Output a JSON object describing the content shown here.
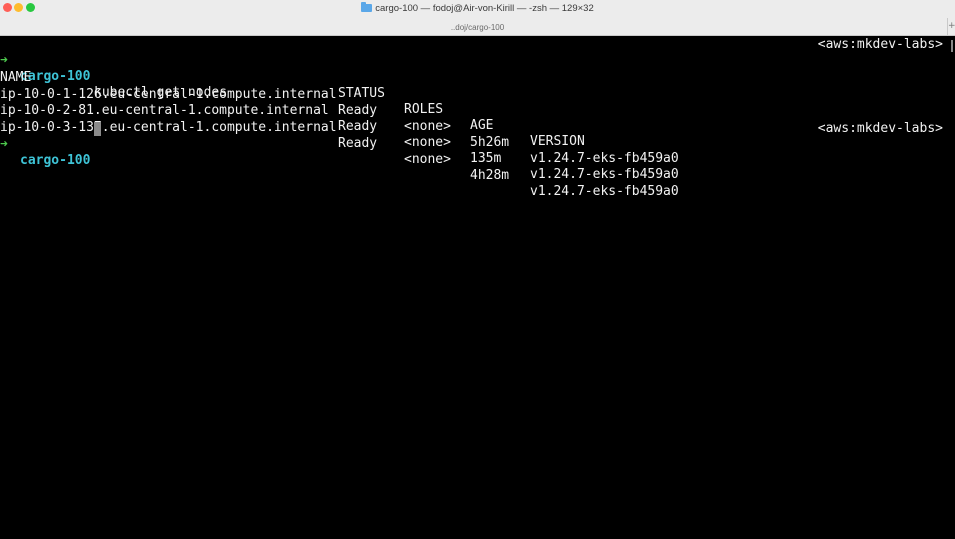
{
  "window": {
    "title": "cargo-100 — fodoj@Air-von-Kirill — -zsh — 129×32",
    "subtitle": "..doj/cargo-100",
    "new_tab_label": "+"
  },
  "terminal": {
    "prompt_arrow": "➜",
    "prompt_dir": "cargo-100",
    "right_prompt": "<aws:mkdev-labs>",
    "command": "kubectl get nodes",
    "table": {
      "headers": [
        "NAME",
        "STATUS",
        "ROLES",
        "AGE",
        "VERSION"
      ],
      "rows": [
        [
          "ip-10-0-1-126.eu-central-1.compute.internal",
          "Ready",
          "<none>",
          "5h26m",
          "v1.24.7-eks-fb459a0"
        ],
        [
          "ip-10-0-2-81.eu-central-1.compute.internal",
          "Ready",
          "<none>",
          "135m",
          "v1.24.7-eks-fb459a0"
        ],
        [
          "ip-10-0-3-137.eu-central-1.compute.internal",
          "Ready",
          "<none>",
          "4h28m",
          "v1.24.7-eks-fb459a0"
        ]
      ]
    }
  },
  "colors": {
    "background": "#000000",
    "prompt_arrow": "#4ec94e",
    "prompt_dir": "#3ec3d6",
    "text": "#f2f2f2"
  }
}
